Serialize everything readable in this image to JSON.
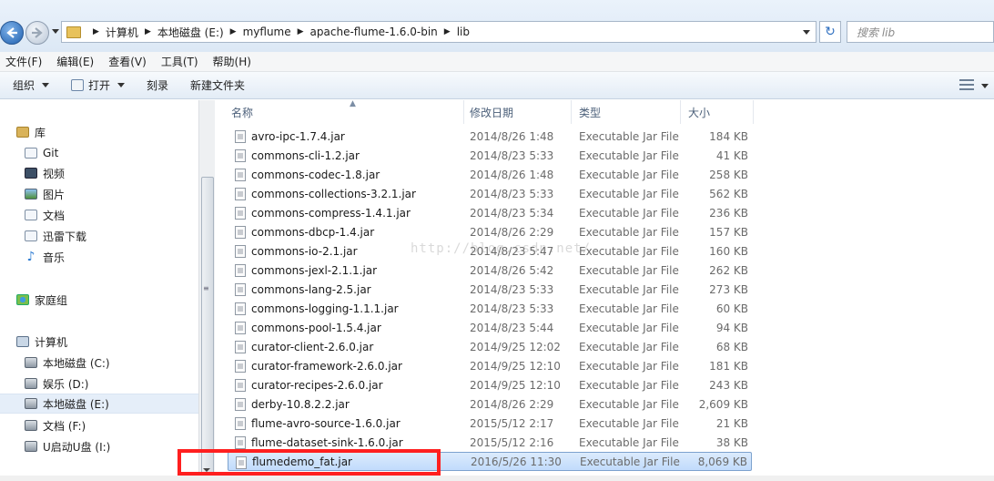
{
  "address_bar": {
    "crumbs": [
      "计算机",
      "本地磁盘 (E:)",
      "myflume",
      "apache-flume-1.6.0-bin",
      "lib"
    ],
    "search_placeholder": "搜索 lib"
  },
  "menubar": {
    "items": [
      "文件(F)",
      "编辑(E)",
      "查看(V)",
      "工具(T)",
      "帮助(H)"
    ]
  },
  "toolbar": {
    "organize": "组织",
    "open": "打开",
    "burn": "刻录",
    "new_folder": "新建文件夹"
  },
  "navpane": {
    "libraries": "库",
    "git": "Git",
    "videos": "视频",
    "pictures": "图片",
    "documents": "文档",
    "thunder": "迅雷下载",
    "music": "音乐",
    "homegroup": "家庭组",
    "computer": "计算机",
    "drive_c": "本地磁盘 (C:)",
    "drive_d": "娱乐 (D:)",
    "drive_e": "本地磁盘 (E:)",
    "drive_f": "文档 (F:)",
    "drive_i": "U启动U盘 (I:)"
  },
  "columns": {
    "name": "名称",
    "date": "修改日期",
    "type": "类型",
    "size": "大小"
  },
  "files": [
    {
      "name": "avro-ipc-1.7.4.jar",
      "date": "2014/8/26 1:48",
      "type": "Executable Jar File",
      "size": "184 KB"
    },
    {
      "name": "commons-cli-1.2.jar",
      "date": "2014/8/23 5:33",
      "type": "Executable Jar File",
      "size": "41 KB"
    },
    {
      "name": "commons-codec-1.8.jar",
      "date": "2014/8/26 1:48",
      "type": "Executable Jar File",
      "size": "258 KB"
    },
    {
      "name": "commons-collections-3.2.1.jar",
      "date": "2014/8/23 5:33",
      "type": "Executable Jar File",
      "size": "562 KB"
    },
    {
      "name": "commons-compress-1.4.1.jar",
      "date": "2014/8/23 5:34",
      "type": "Executable Jar File",
      "size": "236 KB"
    },
    {
      "name": "commons-dbcp-1.4.jar",
      "date": "2014/8/26 2:29",
      "type": "Executable Jar File",
      "size": "157 KB"
    },
    {
      "name": "commons-io-2.1.jar",
      "date": "2014/8/23 5:47",
      "type": "Executable Jar File",
      "size": "160 KB"
    },
    {
      "name": "commons-jexl-2.1.1.jar",
      "date": "2014/8/26 5:42",
      "type": "Executable Jar File",
      "size": "262 KB"
    },
    {
      "name": "commons-lang-2.5.jar",
      "date": "2014/8/23 5:33",
      "type": "Executable Jar File",
      "size": "273 KB"
    },
    {
      "name": "commons-logging-1.1.1.jar",
      "date": "2014/8/23 5:33",
      "type": "Executable Jar File",
      "size": "60 KB"
    },
    {
      "name": "commons-pool-1.5.4.jar",
      "date": "2014/8/23 5:44",
      "type": "Executable Jar File",
      "size": "94 KB"
    },
    {
      "name": "curator-client-2.6.0.jar",
      "date": "2014/9/25 12:02",
      "type": "Executable Jar File",
      "size": "68 KB"
    },
    {
      "name": "curator-framework-2.6.0.jar",
      "date": "2014/9/25 12:10",
      "type": "Executable Jar File",
      "size": "181 KB"
    },
    {
      "name": "curator-recipes-2.6.0.jar",
      "date": "2014/9/25 12:10",
      "type": "Executable Jar File",
      "size": "243 KB"
    },
    {
      "name": "derby-10.8.2.2.jar",
      "date": "2014/8/26 2:29",
      "type": "Executable Jar File",
      "size": "2,609 KB"
    },
    {
      "name": "flume-avro-source-1.6.0.jar",
      "date": "2015/5/12 2:17",
      "type": "Executable Jar File",
      "size": "21 KB"
    },
    {
      "name": "flume-dataset-sink-1.6.0.jar",
      "date": "2015/5/12 2:16",
      "type": "Executable Jar File",
      "size": "38 KB"
    },
    {
      "name": "flumedemo_fat.jar",
      "date": "2016/5/26 11:30",
      "type": "Executable Jar File",
      "size": "8,069 KB"
    }
  ],
  "watermark": "http://blog.csdn.net/"
}
